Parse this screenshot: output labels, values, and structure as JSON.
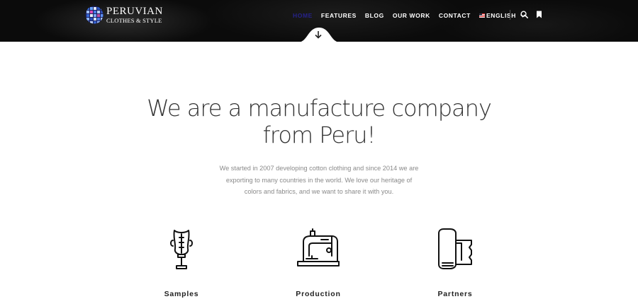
{
  "header": {
    "logo": {
      "title": "PERUVIAN",
      "subtitle": "CLOTHES & STYLE"
    },
    "nav": {
      "items": [
        {
          "label": "HOME",
          "active": true
        },
        {
          "label": "FEATURES",
          "active": false
        },
        {
          "label": "BLOG",
          "active": false
        },
        {
          "label": "OUR WORK",
          "active": false
        },
        {
          "label": "CONTACT",
          "active": false
        }
      ],
      "language": {
        "label": "ENGLISH",
        "icon": "us-flag-icon"
      }
    },
    "icons": [
      "search-icon",
      "bookmark-icon",
      "scroll-down-icon"
    ],
    "colors": {
      "header_bg": "#0b0b0b",
      "active_nav": "#26228a"
    }
  },
  "hero": {
    "headline_line1": "We are a manufacture company",
    "headline_line2": "from Peru!",
    "intro_line1": "We started in 2007 developing cotton clothing and since 2014 we are",
    "intro_line2": "exporting to many countries in the world. We love our heritage of",
    "intro_line3": "colors and fabrics, and we want to share it with you."
  },
  "features": [
    {
      "label": "Samples",
      "icon": "mannequin-icon"
    },
    {
      "label": "Production",
      "icon": "sewing-machine-icon"
    },
    {
      "label": "Partners",
      "icon": "fabric-roll-icon"
    }
  ]
}
